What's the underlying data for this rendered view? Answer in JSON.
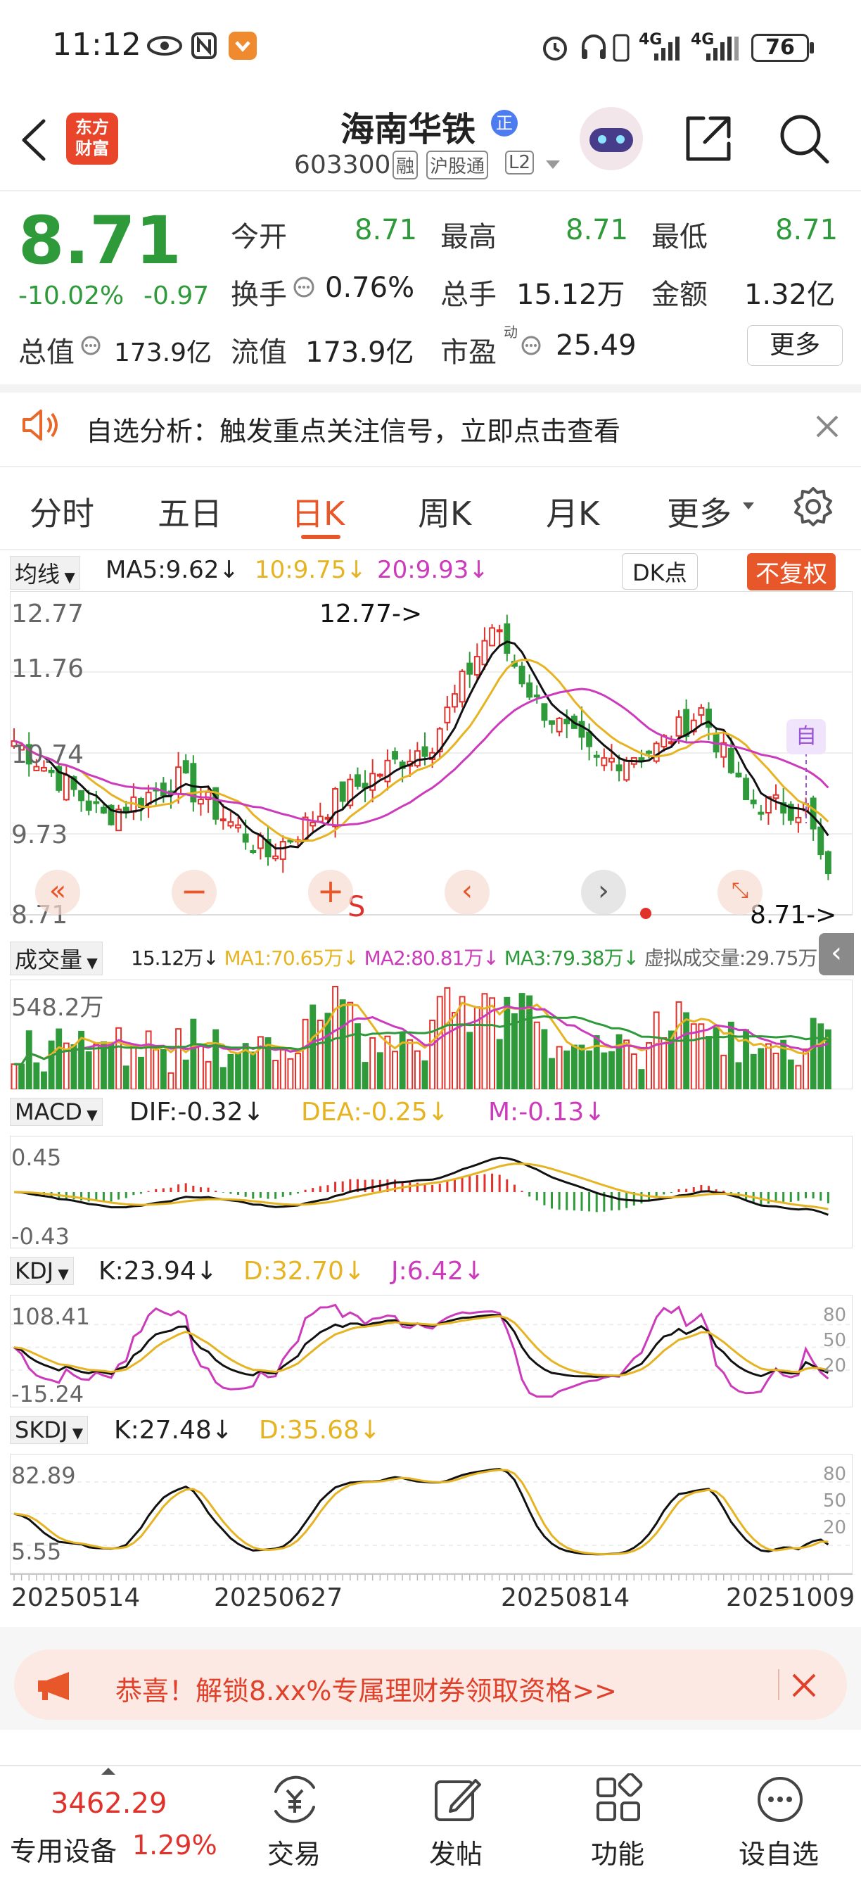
{
  "status": {
    "time": "11:12",
    "battery": "76",
    "net1": "4G",
    "net2": "4G"
  },
  "header": {
    "stock_name": "海南华铁",
    "badge": "正",
    "code": "603300",
    "tag1": "融",
    "tag2": "沪股通",
    "tag3": "L2",
    "logo_line1": "东方",
    "logo_line2": "财富"
  },
  "quote": {
    "price": "8.71",
    "pct": "-10.02%",
    "chg": "-0.97",
    "open_label": "今开",
    "open": "8.71",
    "high_label": "最高",
    "high": "8.71",
    "low_label": "最低",
    "low": "8.71",
    "turnover_label": "换手",
    "turnover": "0.76%",
    "volume_label": "总手",
    "volume": "15.12万",
    "amount_label": "金额",
    "amount": "1.32亿",
    "mcap_label": "总值",
    "mcap": "173.9亿",
    "float_label": "流值",
    "float": "173.9亿",
    "pe_label": "市盈",
    "pe_sup": "动",
    "pe": "25.49",
    "more": "更多"
  },
  "notice": {
    "text": "自选分析：触发重点关注信号，立即点击查看"
  },
  "tabs": [
    "分时",
    "五日",
    "日K",
    "周K",
    "月K",
    "更多"
  ],
  "active_tab": "日K",
  "ma_bar": {
    "selector": "均线",
    "ma5": "MA5:9.62",
    "ma10": "10:9.75",
    "ma20": "20:9.93",
    "dk": "DK点",
    "fq": "不复权"
  },
  "kline": {
    "y_labels": [
      "12.77",
      "11.76",
      "10.74",
      "9.73",
      "8.71"
    ],
    "max_label": "12.77->",
    "last_label": "8.71->",
    "self_tag": "自",
    "s_mark": "S"
  },
  "vol_bar": {
    "selector": "成交量",
    "v": "15.12万",
    "ma1": "MA1:70.65万",
    "ma2": "MA2:80.81万",
    "ma3": "MA3:79.38万",
    "virtual": "虚拟成交量:29.75万",
    "max": "548.2万"
  },
  "macd": {
    "selector": "MACD",
    "dif": "DIF:-0.32",
    "dea": "DEA:-0.25",
    "m": "M:-0.13",
    "top": "0.45",
    "bottom": "-0.43"
  },
  "kdj": {
    "selector": "KDJ",
    "k": "K:23.94",
    "d": "D:32.70",
    "j": "J:6.42",
    "top": "108.41",
    "bottom": "-15.24",
    "r80": "80",
    "r50": "50",
    "r20": "20"
  },
  "skdj": {
    "selector": "SKDJ",
    "k": "K:27.48",
    "d": "D:35.68",
    "top": "82.89",
    "bottom": "5.55",
    "r80": "80",
    "r50": "50",
    "r20": "20"
  },
  "dates": [
    "20250514",
    "20250627",
    "20250814",
    "20251009"
  ],
  "promo": {
    "text": "恭喜！解锁8.xx%专属理财券领取资格>>"
  },
  "bottom": {
    "index_value": "3462.29",
    "index_name": "专用设备",
    "index_pct": "1.29%",
    "trade": "交易",
    "post": "发帖",
    "func": "功能",
    "setself": "设自选"
  }
}
